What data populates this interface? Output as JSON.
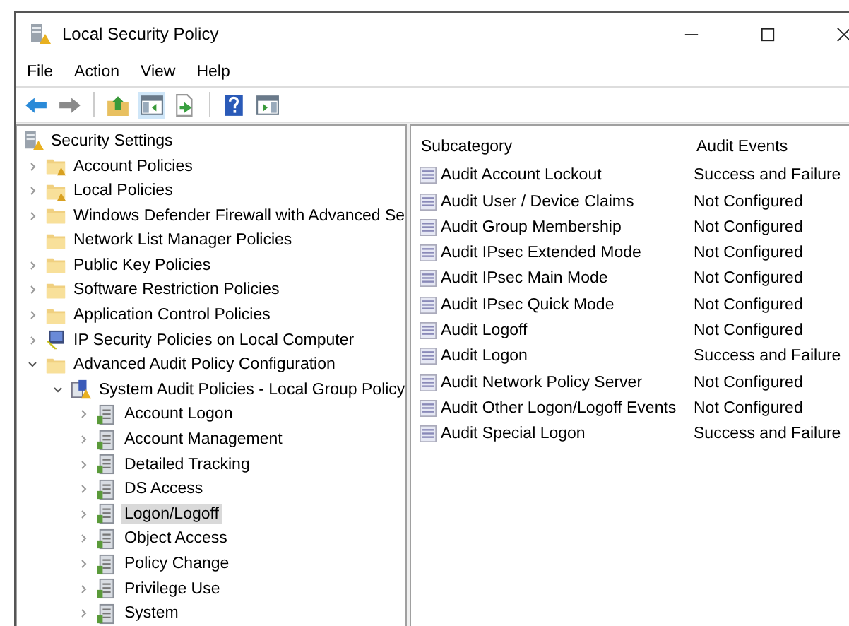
{
  "window": {
    "title": "Local Security Policy"
  },
  "menu": [
    "File",
    "Action",
    "View",
    "Help"
  ],
  "tree": [
    {
      "label": "Security Settings",
      "kind": "settings",
      "selected": false,
      "children": [
        {
          "label": "Account Policies",
          "kind": "lock-folder",
          "expanded": false,
          "selected": false
        },
        {
          "label": "Local Policies",
          "kind": "lock-folder",
          "expanded": false,
          "selected": false
        },
        {
          "label": "Windows Defender Firewall with Advanced Se",
          "kind": "folder",
          "expanded": false,
          "selected": false
        },
        {
          "label": "Network List Manager Policies",
          "kind": "folder",
          "selected": false
        },
        {
          "label": "Public Key Policies",
          "kind": "folder",
          "expanded": false,
          "selected": false
        },
        {
          "label": "Software Restriction Policies",
          "kind": "folder",
          "expanded": false,
          "selected": false
        },
        {
          "label": "Application Control Policies",
          "kind": "folder",
          "expanded": false,
          "selected": false
        },
        {
          "label": "IP Security Policies on Local Computer",
          "kind": "computer",
          "expanded": false,
          "selected": false
        },
        {
          "label": "Advanced Audit Policy Configuration",
          "kind": "folder",
          "expanded": true,
          "selected": false,
          "children": [
            {
              "label": "System Audit Policies - Local Group Policy",
              "kind": "policy",
              "expanded": true,
              "selected": false,
              "children": [
                {
                  "label": "Account Logon",
                  "kind": "audit",
                  "expanded": false,
                  "selected": false
                },
                {
                  "label": "Account Management",
                  "kind": "audit",
                  "expanded": false,
                  "selected": false
                },
                {
                  "label": "Detailed Tracking",
                  "kind": "audit",
                  "expanded": false,
                  "selected": false
                },
                {
                  "label": "DS Access",
                  "kind": "audit",
                  "expanded": false,
                  "selected": false
                },
                {
                  "label": "Logon/Logoff",
                  "kind": "audit",
                  "expanded": false,
                  "selected": true
                },
                {
                  "label": "Object Access",
                  "kind": "audit",
                  "expanded": false,
                  "selected": false
                },
                {
                  "label": "Policy Change",
                  "kind": "audit",
                  "expanded": false,
                  "selected": false
                },
                {
                  "label": "Privilege Use",
                  "kind": "audit",
                  "expanded": false,
                  "selected": false
                },
                {
                  "label": "System",
                  "kind": "audit",
                  "expanded": false,
                  "selected": false
                }
              ]
            }
          ]
        }
      ]
    }
  ],
  "table": {
    "columns": [
      "Subcategory",
      "Audit Events"
    ],
    "rows": [
      [
        "Audit Account Lockout",
        "Success and Failure"
      ],
      [
        "Audit User / Device Claims",
        "Not Configured"
      ],
      [
        "Audit Group Membership",
        "Not Configured"
      ],
      [
        "Audit IPsec Extended Mode",
        "Not Configured"
      ],
      [
        "Audit IPsec Main Mode",
        "Not Configured"
      ],
      [
        "Audit IPsec Quick Mode",
        "Not Configured"
      ],
      [
        "Audit Logoff",
        "Not Configured"
      ],
      [
        "Audit Logon",
        "Success and Failure"
      ],
      [
        "Audit Network Policy Server",
        "Not Configured"
      ],
      [
        "Audit Other Logon/Logoff Events",
        "Not Configured"
      ],
      [
        "Audit Special Logon",
        "Success and Failure"
      ]
    ]
  }
}
